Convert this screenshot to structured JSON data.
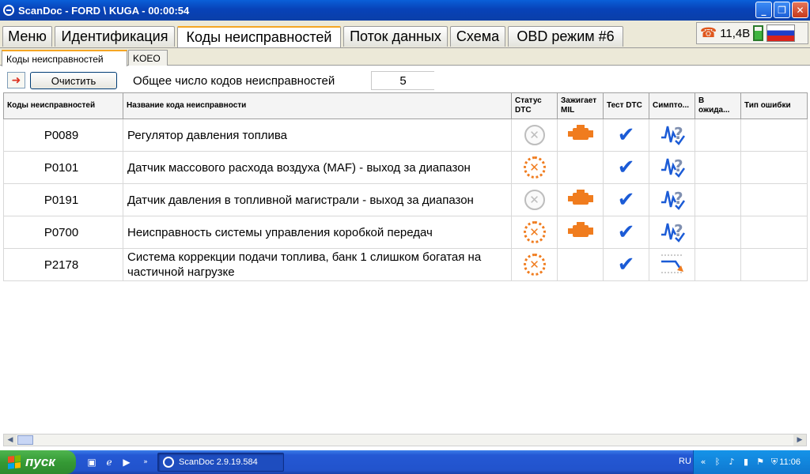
{
  "window": {
    "title": "ScanDoc - FORD \\ KUGA - 00:00:54",
    "minimize_glyph": "_",
    "maximize_glyph": "❐",
    "close_glyph": "✕"
  },
  "main_tabs": [
    {
      "label": "Меню",
      "active": false
    },
    {
      "label": "Идентификация",
      "active": false
    },
    {
      "label": "Коды неисправностей",
      "active": true
    },
    {
      "label": "Поток данных",
      "active": false
    },
    {
      "label": "Схема",
      "active": false
    },
    {
      "label": "OBD режим #6",
      "active": false
    }
  ],
  "status": {
    "voltage": "11,4В",
    "icons": [
      "phone-icon",
      "battery-icon",
      "russia-flag-icon"
    ]
  },
  "sub_tabs": [
    {
      "label": "Коды неисправностей",
      "active": true
    },
    {
      "label": "KOEO",
      "active": false
    }
  ],
  "toolbar": {
    "exit_icon": "exit-arrow-icon",
    "clear_label": "Очистить",
    "total_label": "Общее число кодов неисправностей",
    "total_value": "5"
  },
  "table": {
    "columns": [
      "Коды неисправностей",
      "Название кода неисправности",
      "Статус DTC",
      "Зажигает MIL",
      "Тест DTC",
      "Симпто...",
      "В ожида...",
      "Тип ошибки"
    ],
    "rows": [
      {
        "code": "P0089",
        "name": "Регулятор давления топлива",
        "status": "inactive",
        "mil": true,
        "test": true,
        "symptom": "intermittent"
      },
      {
        "code": "P0101",
        "name": "Датчик массового расхода воздуха (MAF) - выход за диапазон",
        "status": "active",
        "mil": false,
        "test": true,
        "symptom": "intermittent"
      },
      {
        "code": "P0191",
        "name": "Датчик давления в топливной магистрали - выход за диапазон",
        "status": "inactive",
        "mil": true,
        "test": true,
        "symptom": "intermittent"
      },
      {
        "code": "P0700",
        "name": "Неисправность системы управления коробкой передач",
        "status": "active",
        "mil": true,
        "test": true,
        "symptom": "intermittent"
      },
      {
        "code": "P2178",
        "name": "Система коррекции подачи топлива, банк 1 слишком богатая на частичной нагрузке",
        "status": "active",
        "mil": false,
        "test": true,
        "symptom": "too-rich"
      }
    ]
  },
  "taskbar": {
    "start_label": "пуск",
    "task_label": "ScanDoc 2.9.19.584",
    "language": "RU",
    "clock": "11:06"
  },
  "colors": {
    "accent_orange": "#f07c1e",
    "check_blue": "#1b5bd6",
    "titlebar_blue": "#0842b8"
  }
}
